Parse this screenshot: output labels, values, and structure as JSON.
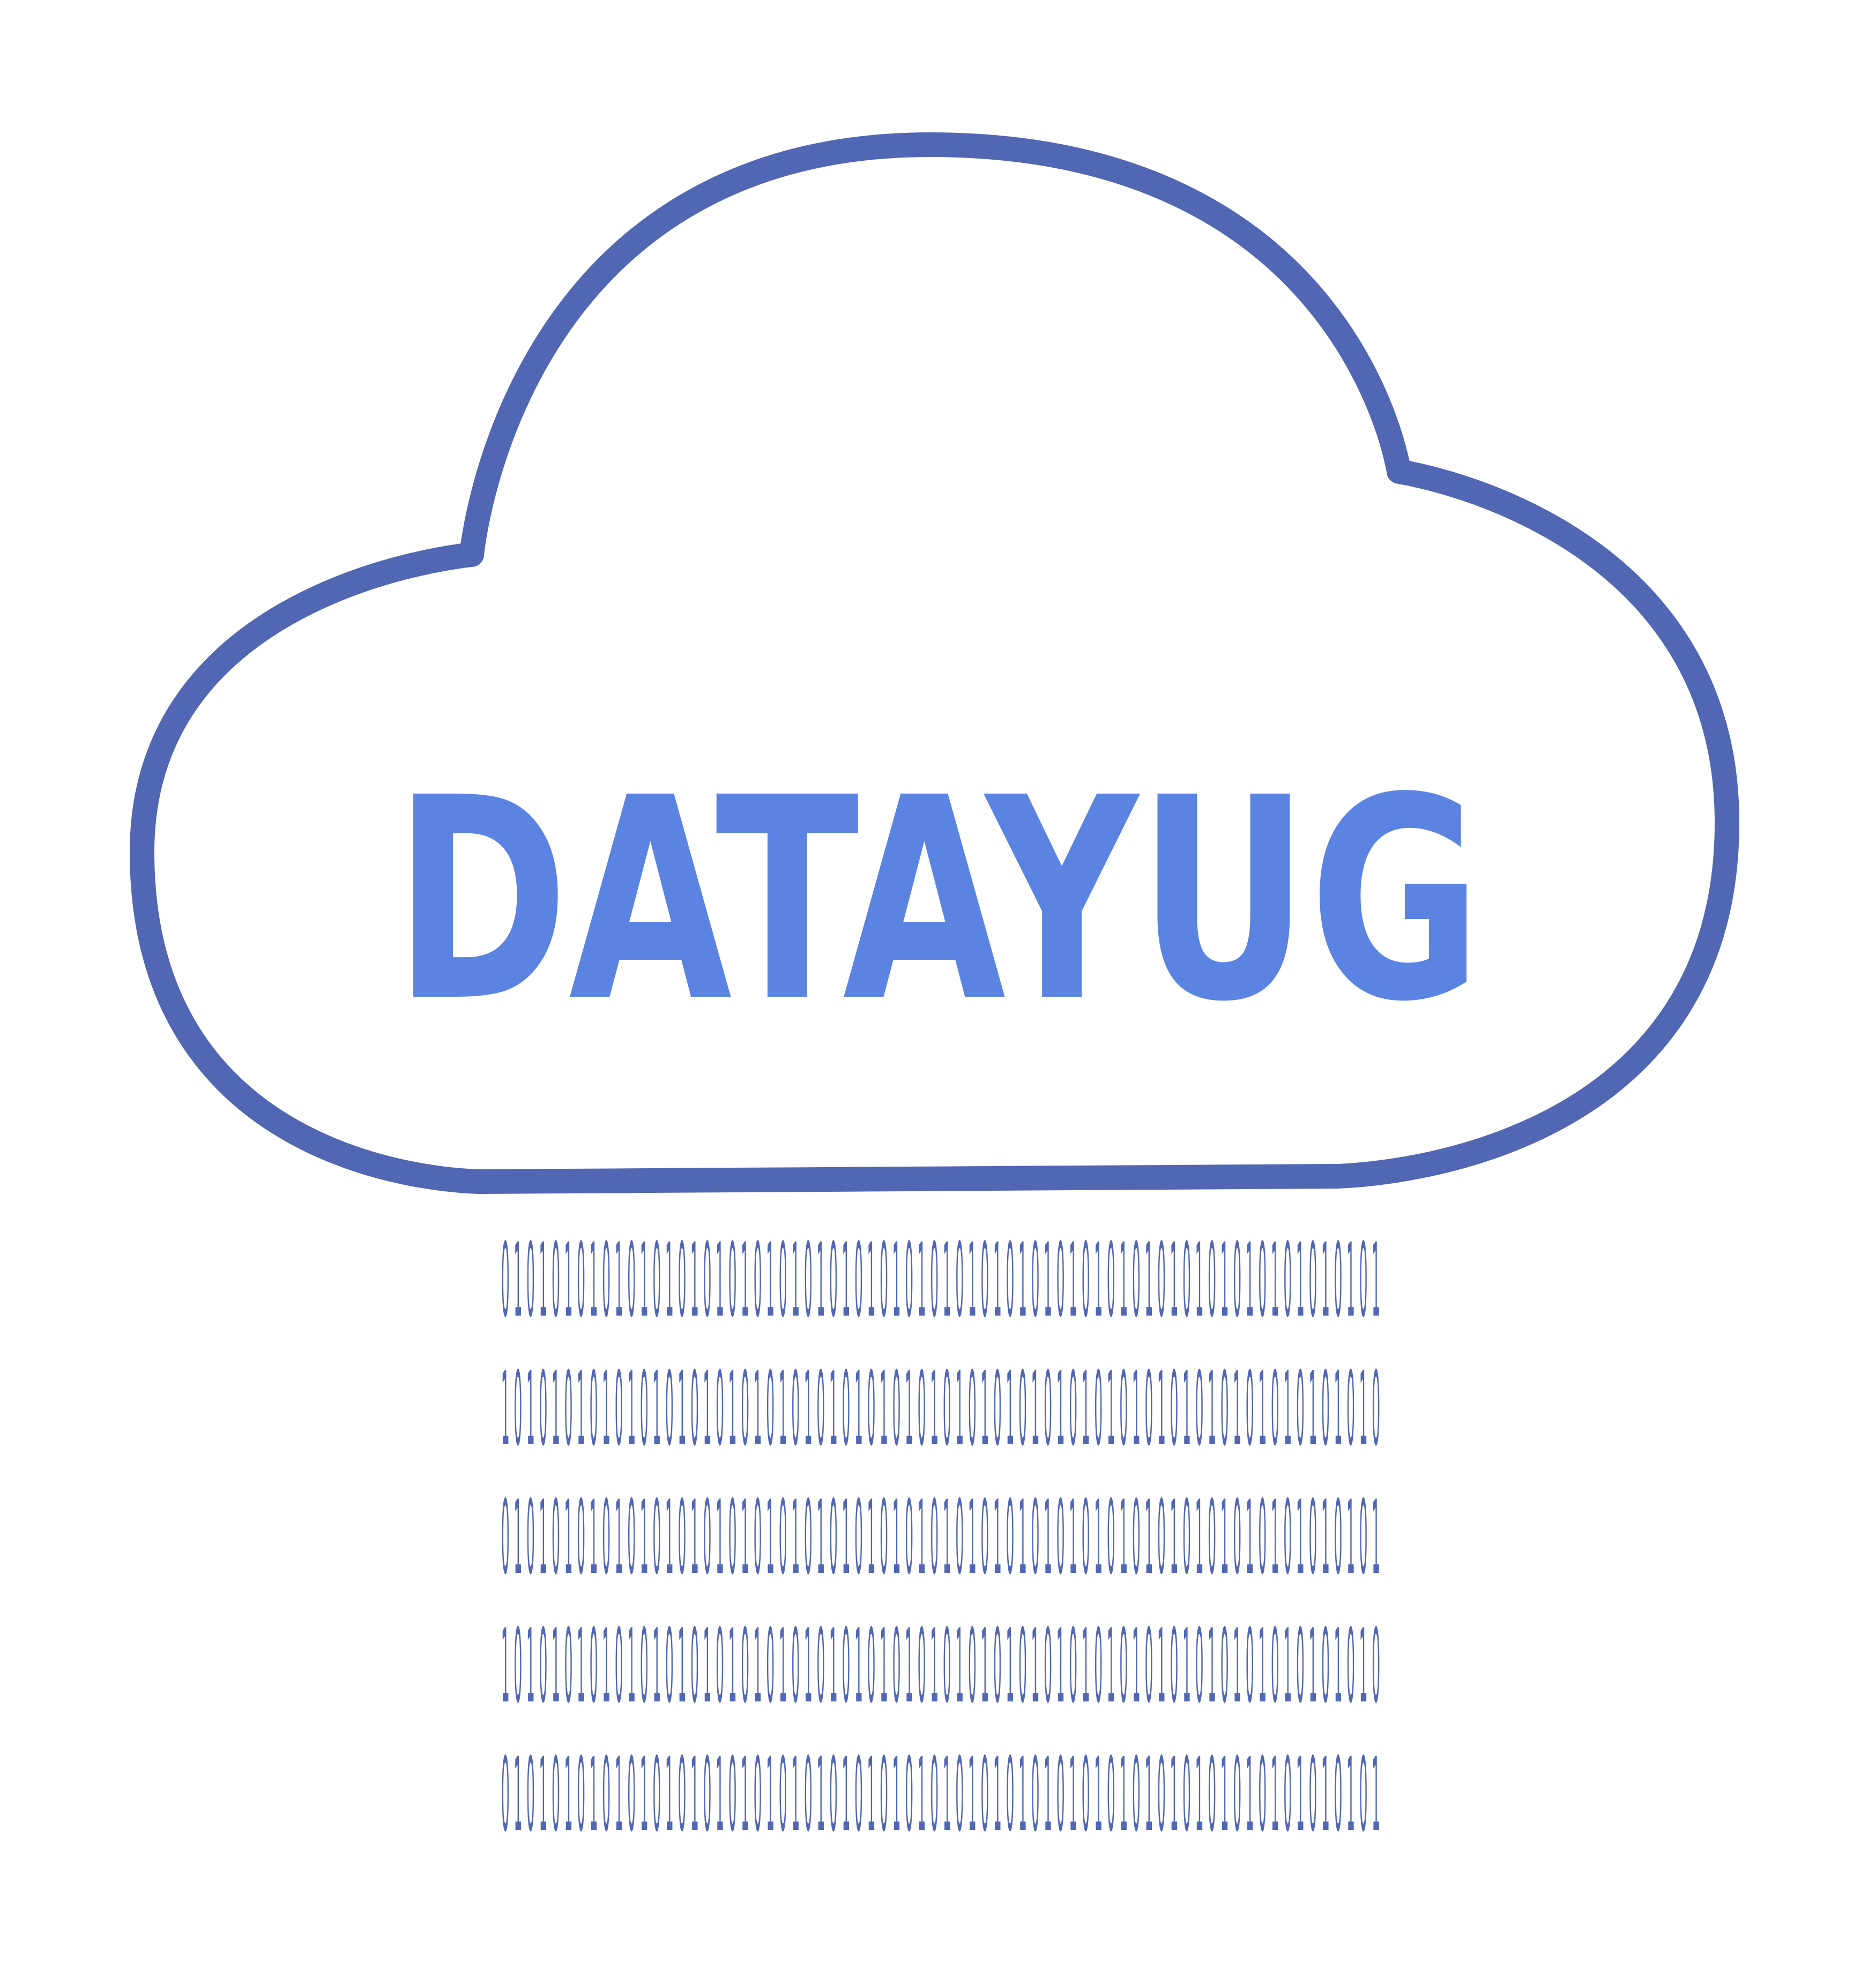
{
  "logo": {
    "brand_name": "DATAYUG",
    "brand_color": "#5B83E2",
    "cloud_outline_color": "#5267B4",
    "binary_color": "#5267B4",
    "background_color": "#FFFFFF",
    "icon": "cloud-icon"
  },
  "binary_rows": [
    "0 1 0 1 0 1 0 1 0 1 0 1 0 1 0 1 0 1 0 1 0 1 0 1 0 1 0 1 0 1 0 1 0 1 0 1 0 1 0 1 0 1 0 1 0 1 0 1 0 1 0 1 0 1 0 1 0 1 0 1 0 1 0 1 0 1 0 1 0 1",
    "1 0 1 0 1 0 1 0 1 0 1 0 1 0 1 0 1 0 1 0 1 0 1 0 1 0 1 0 1 0 1 0 1 0 1 0 1 0 1 0 1 0 1 0 1 0 1 0 1 0 1 0 1 0 1 0 1 0 1 0 1 0 1 0 1 0 1 0 1 0",
    "0 1 0 1 0 1 0 1 0 1 0 1 0 1 0 1 0 1 0 1 0 1 0 1 0 1 0 1 0 1 0 1 0 1 0 1 0 1 0 1 0 1 0 1 0 1 0 1 0 1 0 1 0 1 0 1 0 1 0 1 0 1 0 1 0 1 0 1 0 1",
    "1 0 1 0 1 0 1 0 1 0 1 0 1 0 1 0 1 0 1 0 1 0 1 0 1 0 1 0 1 0 1 0 1 0 1 0 1 0 1 0 1 0 1 0 1 0 1 0 1 0 1 0 1 0 1 0 1 0 1 0 1 0 1 0 1 0 1 0 1 0",
    "0 1 0 1 0 1 0 1 0 1 0 1 0 1 0 1 0 1 0 1 0 1 0 1 0 1 0 1 0 1 0 1 0 1 0 1 0 1 0 1 0 1 0 1 0 1 0 1 0 1 0 1 0 1 0 1 0 1 0 1 0 1 0 1 0 1 0 1 0 1"
  ]
}
